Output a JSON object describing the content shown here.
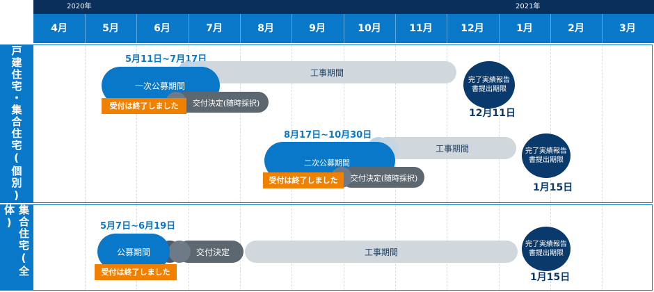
{
  "header": {
    "years": [
      "2020年",
      "2021年"
    ],
    "months": [
      "4月",
      "5月",
      "6月",
      "7月",
      "8月",
      "9月",
      "10月",
      "11月",
      "12月",
      "1月",
      "2月",
      "3月"
    ]
  },
  "rows": [
    {
      "label": "戸建住宅・集合住宅(個別)",
      "phases": [
        {
          "date_range": "5月11日~7月17日",
          "apply": "一次公募期間",
          "closed": "受付は終了しました",
          "decision": "交付決定(随時採択)",
          "construction": "工事期間",
          "deadline_title": "完了実績報告\n書提出期限",
          "deadline_date": "12月11日"
        },
        {
          "date_range": "8月17日~10月30日",
          "apply": "二次公募期間",
          "closed": "受付は終了しました",
          "decision": "交付決定(随時採択)",
          "construction": "工事期間",
          "deadline_title": "完了実績報告\n書提出期限",
          "deadline_date": "1月15日"
        }
      ]
    },
    {
      "label": "集合住宅(全体)",
      "phases": [
        {
          "date_range": "5月7日~6月19日",
          "apply": "公募期間",
          "closed": "受付は終了しました",
          "decision": "交付決定",
          "construction": "工事期間",
          "deadline_title": "完了実績報告\n書提出期限",
          "deadline_date": "1月15日"
        }
      ]
    }
  ]
}
